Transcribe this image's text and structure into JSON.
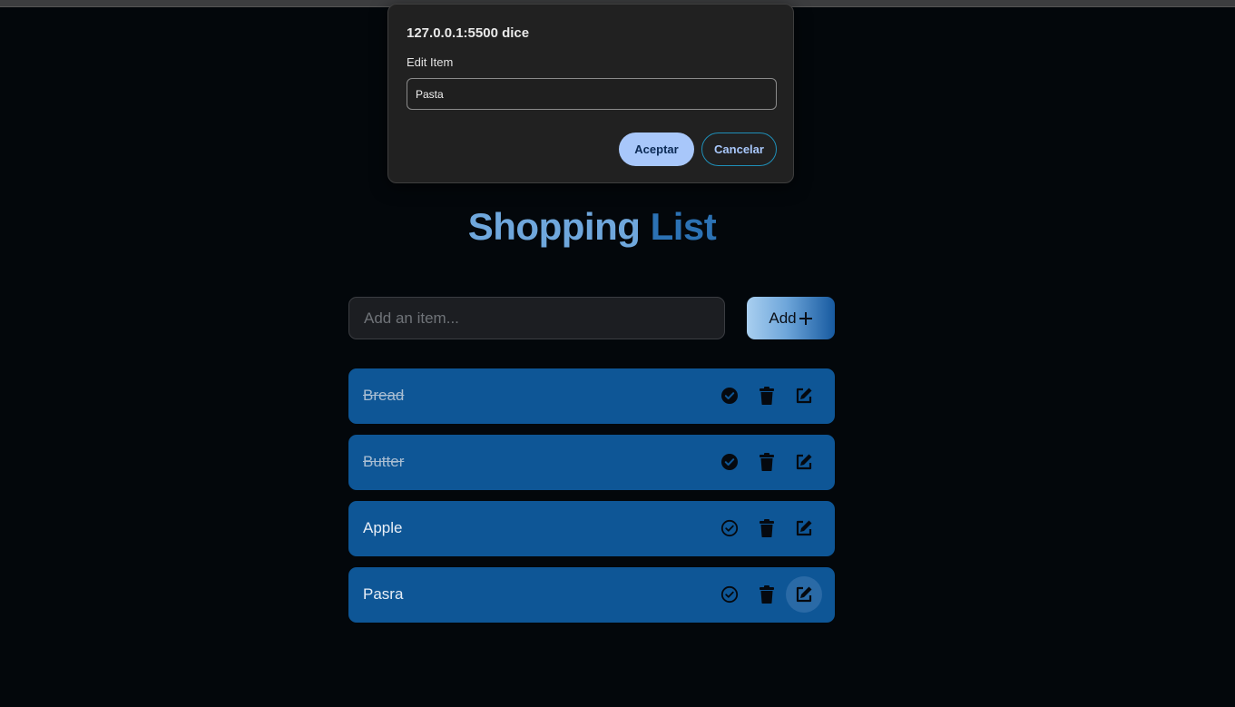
{
  "dialog": {
    "origin": "127.0.0.1:5500 dice",
    "message": "Edit Item",
    "input_value": "Pasta",
    "ok_label": "Aceptar",
    "cancel_label": "Cancelar"
  },
  "page": {
    "title_part1": "Shopping",
    "title_part2": "List"
  },
  "add_form": {
    "placeholder": "Add an item...",
    "button_label": "Add",
    "button_icon": "plus-icon"
  },
  "items": [
    {
      "label": "Bread",
      "done": true
    },
    {
      "label": "Butter",
      "done": true
    },
    {
      "label": "Apple",
      "done": false
    },
    {
      "label": "Pasra",
      "done": false
    }
  ],
  "colors": {
    "background": "#03070b",
    "item_bg": "#0e5696",
    "accent_light": "#6fa7dc",
    "accent_dark": "#2c72b4",
    "dialog_ok": "#a8c7fa"
  }
}
